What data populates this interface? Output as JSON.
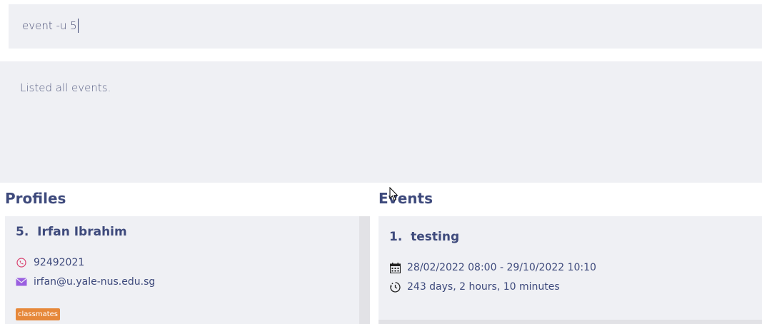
{
  "command": {
    "value": "event -u 5"
  },
  "result": {
    "message": "Listed all events."
  },
  "profiles": {
    "title": "Profiles",
    "cards": [
      {
        "index_name": "5.  Irfan Ibrahim",
        "phone": "92492021",
        "email": "irfan@u.yale-nus.edu.sg",
        "tags": [
          "classmates"
        ]
      }
    ]
  },
  "events": {
    "title": "Events",
    "cards": [
      {
        "index_name": "1.  testing",
        "datetime_range": "28/02/2022 08:00 - 29/10/2022 10:10",
        "duration": "243 days, 2 hours, 10 minutes"
      }
    ]
  },
  "colors": {
    "accent_title": "#3e4a7c",
    "panel_bg": "#eff0f4",
    "tag_bg": "#e6883a",
    "phone_icon": "#d9416e",
    "email_icon": "#9a5fe0"
  },
  "icons": [
    "phone-icon",
    "email-icon",
    "calendar-icon",
    "clock-icon",
    "mouse-pointer-icon"
  ]
}
